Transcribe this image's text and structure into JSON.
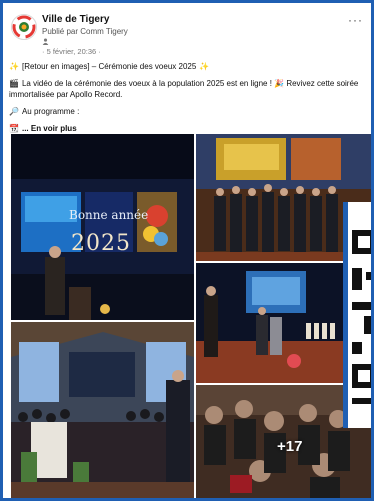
{
  "post": {
    "page_name": "Ville de Tigery",
    "published_by": "Publié par Comm Tigery",
    "date": "· 5 février, 20:36 ·",
    "more_label": "···"
  },
  "body": {
    "line1": "[Retour en images] – Cérémonie des voeux 2025",
    "line2": "La vidéo de la cérémonie des voeux à la population 2025 est en ligne ! 🎉 Revivez cette soirée immortalisée par Apollo Record.",
    "line3": "Au programme :",
    "line4": "... En voir plus"
  },
  "gallery": {
    "screen_text": "Bonne année",
    "screen_year": "2025",
    "more_count": "+17"
  },
  "colors": {
    "brand_blue": "#1f5fb3",
    "stage_blue": "#1a2f6e"
  }
}
